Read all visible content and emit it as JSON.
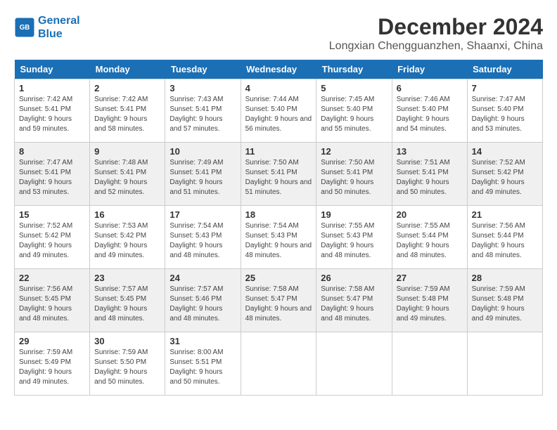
{
  "logo": {
    "line1": "General",
    "line2": "Blue"
  },
  "title": "December 2024",
  "subtitle": "Longxian Chengguanzhen, Shaanxi, China",
  "days_of_week": [
    "Sunday",
    "Monday",
    "Tuesday",
    "Wednesday",
    "Thursday",
    "Friday",
    "Saturday"
  ],
  "weeks": [
    [
      {
        "day": "1",
        "sunrise": "7:42 AM",
        "sunset": "5:41 PM",
        "daylight": "9 hours and 59 minutes."
      },
      {
        "day": "2",
        "sunrise": "7:42 AM",
        "sunset": "5:41 PM",
        "daylight": "9 hours and 58 minutes."
      },
      {
        "day": "3",
        "sunrise": "7:43 AM",
        "sunset": "5:41 PM",
        "daylight": "9 hours and 57 minutes."
      },
      {
        "day": "4",
        "sunrise": "7:44 AM",
        "sunset": "5:40 PM",
        "daylight": "9 hours and 56 minutes."
      },
      {
        "day": "5",
        "sunrise": "7:45 AM",
        "sunset": "5:40 PM",
        "daylight": "9 hours and 55 minutes."
      },
      {
        "day": "6",
        "sunrise": "7:46 AM",
        "sunset": "5:40 PM",
        "daylight": "9 hours and 54 minutes."
      },
      {
        "day": "7",
        "sunrise": "7:47 AM",
        "sunset": "5:40 PM",
        "daylight": "9 hours and 53 minutes."
      }
    ],
    [
      {
        "day": "8",
        "sunrise": "7:47 AM",
        "sunset": "5:41 PM",
        "daylight": "9 hours and 53 minutes."
      },
      {
        "day": "9",
        "sunrise": "7:48 AM",
        "sunset": "5:41 PM",
        "daylight": "9 hours and 52 minutes."
      },
      {
        "day": "10",
        "sunrise": "7:49 AM",
        "sunset": "5:41 PM",
        "daylight": "9 hours and 51 minutes."
      },
      {
        "day": "11",
        "sunrise": "7:50 AM",
        "sunset": "5:41 PM",
        "daylight": "9 hours and 51 minutes."
      },
      {
        "day": "12",
        "sunrise": "7:50 AM",
        "sunset": "5:41 PM",
        "daylight": "9 hours and 50 minutes."
      },
      {
        "day": "13",
        "sunrise": "7:51 AM",
        "sunset": "5:41 PM",
        "daylight": "9 hours and 50 minutes."
      },
      {
        "day": "14",
        "sunrise": "7:52 AM",
        "sunset": "5:42 PM",
        "daylight": "9 hours and 49 minutes."
      }
    ],
    [
      {
        "day": "15",
        "sunrise": "7:52 AM",
        "sunset": "5:42 PM",
        "daylight": "9 hours and 49 minutes."
      },
      {
        "day": "16",
        "sunrise": "7:53 AM",
        "sunset": "5:42 PM",
        "daylight": "9 hours and 49 minutes."
      },
      {
        "day": "17",
        "sunrise": "7:54 AM",
        "sunset": "5:43 PM",
        "daylight": "9 hours and 48 minutes."
      },
      {
        "day": "18",
        "sunrise": "7:54 AM",
        "sunset": "5:43 PM",
        "daylight": "9 hours and 48 minutes."
      },
      {
        "day": "19",
        "sunrise": "7:55 AM",
        "sunset": "5:43 PM",
        "daylight": "9 hours and 48 minutes."
      },
      {
        "day": "20",
        "sunrise": "7:55 AM",
        "sunset": "5:44 PM",
        "daylight": "9 hours and 48 minutes."
      },
      {
        "day": "21",
        "sunrise": "7:56 AM",
        "sunset": "5:44 PM",
        "daylight": "9 hours and 48 minutes."
      }
    ],
    [
      {
        "day": "22",
        "sunrise": "7:56 AM",
        "sunset": "5:45 PM",
        "daylight": "9 hours and 48 minutes."
      },
      {
        "day": "23",
        "sunrise": "7:57 AM",
        "sunset": "5:45 PM",
        "daylight": "9 hours and 48 minutes."
      },
      {
        "day": "24",
        "sunrise": "7:57 AM",
        "sunset": "5:46 PM",
        "daylight": "9 hours and 48 minutes."
      },
      {
        "day": "25",
        "sunrise": "7:58 AM",
        "sunset": "5:47 PM",
        "daylight": "9 hours and 48 minutes."
      },
      {
        "day": "26",
        "sunrise": "7:58 AM",
        "sunset": "5:47 PM",
        "daylight": "9 hours and 48 minutes."
      },
      {
        "day": "27",
        "sunrise": "7:59 AM",
        "sunset": "5:48 PM",
        "daylight": "9 hours and 49 minutes."
      },
      {
        "day": "28",
        "sunrise": "7:59 AM",
        "sunset": "5:48 PM",
        "daylight": "9 hours and 49 minutes."
      }
    ],
    [
      {
        "day": "29",
        "sunrise": "7:59 AM",
        "sunset": "5:49 PM",
        "daylight": "9 hours and 49 minutes."
      },
      {
        "day": "30",
        "sunrise": "7:59 AM",
        "sunset": "5:50 PM",
        "daylight": "9 hours and 50 minutes."
      },
      {
        "day": "31",
        "sunrise": "8:00 AM",
        "sunset": "5:51 PM",
        "daylight": "9 hours and 50 minutes."
      },
      null,
      null,
      null,
      null
    ]
  ]
}
